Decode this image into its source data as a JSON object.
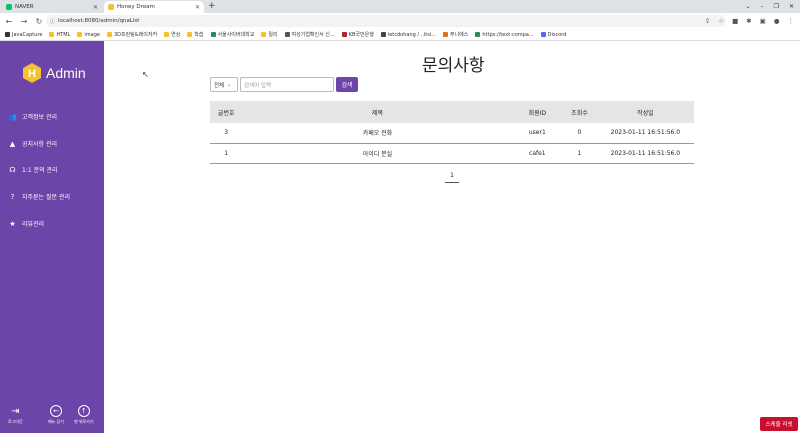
{
  "browser": {
    "tabs": [
      {
        "label": "NAVER",
        "color": "#03c75a"
      },
      {
        "label": "Honey Dream",
        "color": "#f2c230"
      }
    ],
    "url": "localhost:8080/admin/qnaList",
    "bookmarks": [
      "JavaCapture",
      "HTML",
      "image",
      "3D프린팅&레이저커",
      "연상",
      "학습",
      "서울사이버대학교",
      "릴리",
      "여성기업확인서 신...",
      "KB국민은행",
      "letcdohang / ..itsi...",
      "푸니에스",
      "https://text-compa...",
      "Discord"
    ]
  },
  "sidebar": {
    "brand": "Admin",
    "items": [
      {
        "label": "고객정보 관리",
        "icon": "users-icon"
      },
      {
        "label": "공지사항 관리",
        "icon": "warning-icon"
      },
      {
        "label": "1:1 문의 관리",
        "icon": "headset-icon"
      },
      {
        "label": "자주묻는 질문 관리",
        "icon": "question-icon"
      },
      {
        "label": "리뷰관리",
        "icon": "star-icon"
      }
    ],
    "bottom": {
      "logout": "로그아웃",
      "hide_menu": "메뉴 닫기",
      "top": "맨 위로가기"
    }
  },
  "main": {
    "title": "문의사항",
    "search": {
      "select_value": "전체",
      "placeholder": "검색어 입력",
      "button": "검색"
    },
    "table": {
      "headers": [
        "글번호",
        "제목",
        "회원ID",
        "조회수",
        "작성일"
      ],
      "rows": [
        {
          "no": "3",
          "title": "카페오 전화",
          "id": "user1",
          "views": "0",
          "date": "2023-01-11 16:51:56.0"
        },
        {
          "no": "1",
          "title": "아이디 분실",
          "id": "cafe1",
          "views": "1",
          "date": "2023-01-11 16:51:56.0"
        }
      ]
    },
    "pager": {
      "current": "1"
    }
  },
  "reset_button": "스케줄 리셋",
  "colors": {
    "brand": "#6b45a8",
    "reset": "#c8102e"
  }
}
